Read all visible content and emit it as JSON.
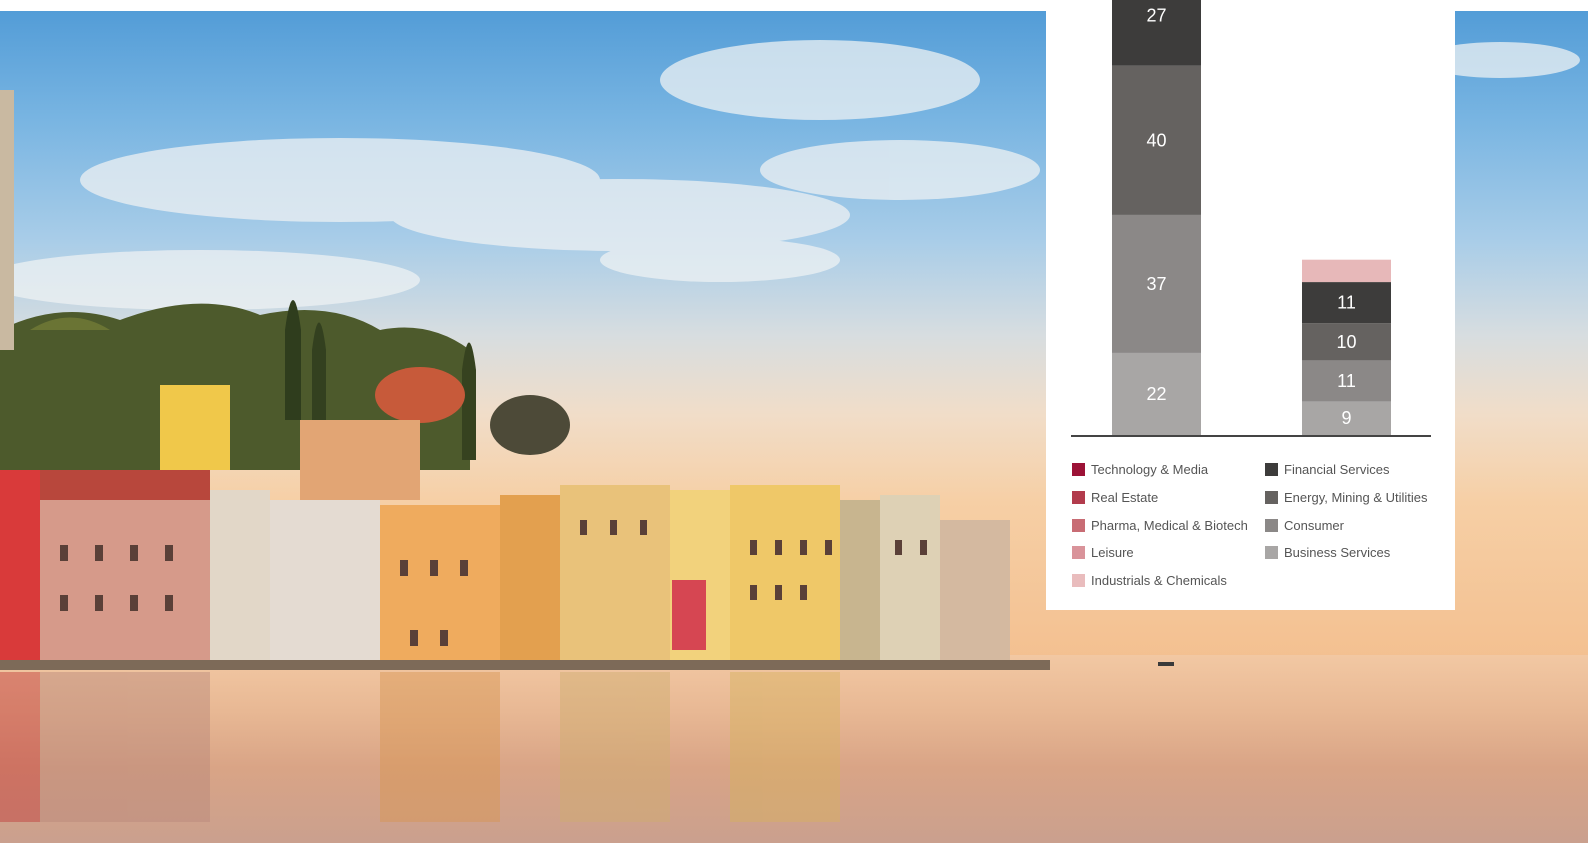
{
  "chart_data": {
    "type": "bar",
    "stacked": true,
    "categories": [
      "",
      ""
    ],
    "series": [
      {
        "name": "Business Services",
        "values": [
          22,
          9
        ],
        "color": "#a8a6a5"
      },
      {
        "name": "Consumer",
        "values": [
          37,
          11
        ],
        "color": "#8b8887"
      },
      {
        "name": "Energy, Mining & Utilities",
        "values": [
          40,
          10
        ],
        "color": "#656260"
      },
      {
        "name": "Financial Services",
        "values": [
          27,
          11
        ],
        "color": "#3d3c3b"
      },
      {
        "name": "Industrials & Chemicals",
        "values": [
          null,
          6
        ],
        "color": "#e7b8b9"
      }
    ],
    "legend": {
      "left": [
        {
          "label": "Technology & Media",
          "color": "#9c1236"
        },
        {
          "label": "Real Estate",
          "color": "#b23b4c"
        },
        {
          "label": "Pharma, Medical & Biotech",
          "color": "#c86c74"
        },
        {
          "label": "Leisure",
          "color": "#d9939a"
        },
        {
          "label": "Industrials & Chemicals",
          "color": "#e9bcbd"
        }
      ],
      "right": [
        {
          "label": "Financial Services",
          "color": "#3d3c3b"
        },
        {
          "label": "Energy, Mining & Utilities",
          "color": "#656260"
        },
        {
          "label": "Consumer",
          "color": "#8b8887"
        },
        {
          "label": "Business Services",
          "color": "#a8a6a5"
        }
      ]
    },
    "legend_position": "bottom",
    "grid": false,
    "title": "",
    "xlabel": "",
    "ylabel": ""
  },
  "colors": {
    "card_background": "#ffffff",
    "axis": "#444444",
    "label_text": "#ffffff"
  }
}
